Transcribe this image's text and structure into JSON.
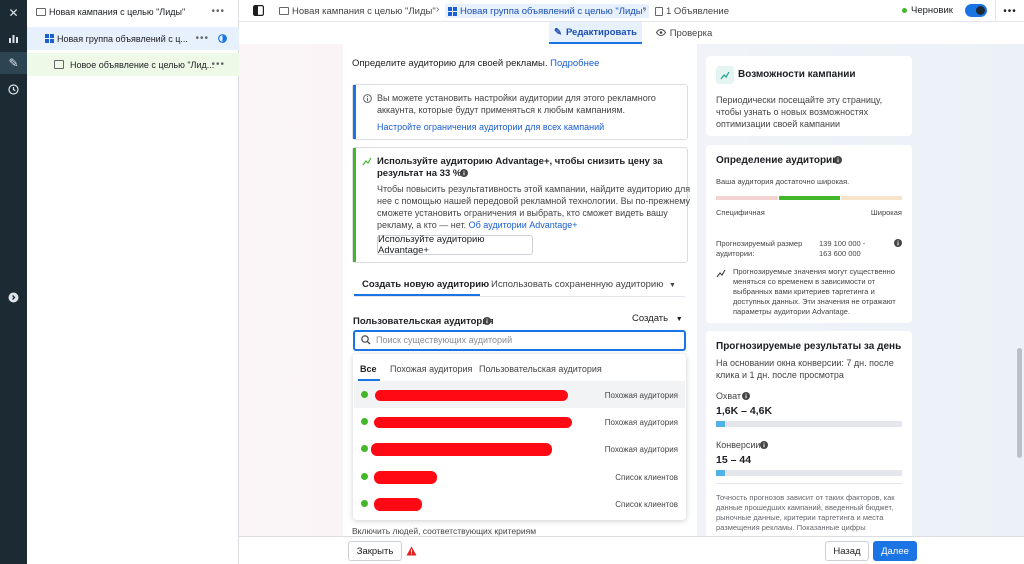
{
  "rail": {
    "items": [
      "close-icon",
      "chart-icon",
      "pencil-icon",
      "clock-icon",
      "expand-icon"
    ]
  },
  "tree": {
    "campaign": "Новая кампания с целью \"Лиды\"",
    "adset": "Новая группа объявлений с ц...",
    "ad": "Новое объявление с целью \"Лид...",
    "more": "•••"
  },
  "breadcrumb": {
    "campaign": "Новая кампания с целью \"Лиды\"",
    "adset": "Новая группа объявлений с целью \"Лиды\"",
    "ads": "1 Объявление",
    "sep": "›"
  },
  "status": {
    "label": "Черновик"
  },
  "modes": {
    "edit": "Редактировать",
    "review": "Проверка"
  },
  "audience": {
    "intro": "Определите аудиторию для своей рекламы.",
    "intro_link": "Подробнее",
    "info_text_1": "Вы можете установить настройки аудитории для этого рекламного",
    "info_text_2": "аккаунта, которые будут применяться к любым кампаниям.",
    "info_link": "Настройте ограничения аудитории для всех кампаний",
    "adv_title_1": "Используйте аудиторию Advantage+, чтобы снизить цену за",
    "adv_title_2": "результат на 33 %",
    "adv_body_1": "Чтобы повысить результативность этой кампании, найдите аудиторию для",
    "adv_body_2": "нее с помощью нашей передовой рекламной технологии. Вы по-прежнему",
    "adv_body_3": "сможете установить ограничения и выбрать, кто сможет видеть вашу",
    "adv_body_4": "рекламу, а кто — нет.",
    "adv_link": "Об аудитории Advantage+",
    "adv_button": "Используйте аудиторию Advantage+",
    "tab_new": "Создать новую аудиторию",
    "tab_saved": "Использовать сохраненную аудиторию",
    "custom_label": "Пользовательская аудитория",
    "create_label": "Создать",
    "search_placeholder": "Поиск существующих аудиторий",
    "filter_tabs": [
      "Все",
      "Похожая аудитория",
      "Пользовательская аудитория"
    ],
    "rows": [
      {
        "type": "Похожая аудитория"
      },
      {
        "type": "Похожая аудитория"
      },
      {
        "type": "Похожая аудитория"
      },
      {
        "type": "Список клиентов"
      },
      {
        "type": "Список клиентов"
      }
    ],
    "bottom_text": "Включить людей, соответствующих критериям"
  },
  "right": {
    "capabilities_title": "Возможности кампании",
    "capabilities_body_1": "Периодически посещайте эту страницу,",
    "capabilities_body_2": "чтобы узнать о новых возможностях",
    "capabilities_body_3": "оптимизации своей кампании",
    "def_title": "Определение аудитории",
    "def_status": "Ваша аудитория достаточно широкая.",
    "specific": "Специфичная",
    "broad": "Широкая",
    "size_label_1": "Прогнозируемый размер",
    "size_label_2": "аудитории:",
    "size_value_1": "139 100 000 -",
    "size_value_2": "163 600 000",
    "note_1": "Прогнозируемые значения могут существенно",
    "note_2": "меняться со временем в зависимости от",
    "note_3": "выбранных вами критериев таргетинга и",
    "note_4": "доступных данных. Эти значения не отражают",
    "note_5": "параметры аудитории Advantage.",
    "daily_title": "Прогнозируемые результаты за день",
    "daily_sub_1": "На основании окна конверсии: 7 дн. после",
    "daily_sub_2": "клика и 1 дн. после просмотра",
    "reach_label": "Охват",
    "reach_value": "1,6K – 4,6K",
    "reach_level": 0.05,
    "conv_label": "Конверсии",
    "conv_value": "15 – 44",
    "conv_level": 0.05,
    "acc_1": "Точность прогнозов зависит от таких факторов, как",
    "acc_2": "данные прошедших кампаний, введенный бюджет,",
    "acc_3": "рыночные данные, критерии таргетинга и места",
    "acc_4": "размещения рекламы. Показанные цифры"
  },
  "footer": {
    "close": "Закрыть",
    "back": "Назад",
    "next": "Далее"
  },
  "colors": {
    "accent": "#1b74e4",
    "rail": "#1c2b33",
    "success": "#42b72a",
    "redact": "#ff0a14",
    "warn": "#e02020"
  }
}
